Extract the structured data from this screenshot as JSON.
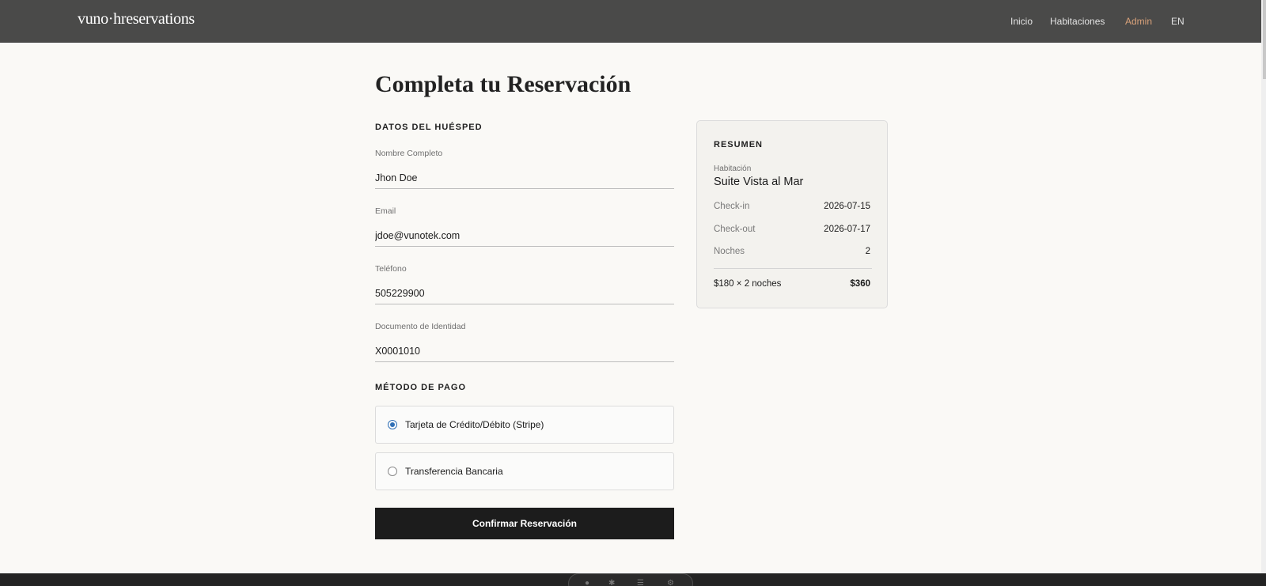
{
  "header": {
    "brand": "vuno·hreservations",
    "nav": [
      "Inicio",
      "Habitaciones",
      "Admin",
      "EN"
    ]
  },
  "page": {
    "title": "Completa tu Reservación"
  },
  "guest": {
    "section_title": "DATOS DEL HUÉSPED",
    "fields": [
      {
        "label": "Nombre Completo",
        "value": "Jhon Doe"
      },
      {
        "label": "Email",
        "value": "jdoe@vunotek.com"
      },
      {
        "label": "Teléfono",
        "value": "505229900"
      },
      {
        "label": "Documento de Identidad",
        "value": "X0001010"
      }
    ]
  },
  "payment": {
    "section_title": "MÉTODO DE PAGO",
    "options": [
      {
        "label": "Tarjeta de Crédito/Débito (Stripe)",
        "selected": true
      },
      {
        "label": "Transferencia Bancaria",
        "selected": false
      }
    ],
    "confirm_label": "Confirmar Reservación"
  },
  "summary": {
    "title": "RESUMEN",
    "room_label": "Habitación",
    "room_name": "Suite Vista al Mar",
    "rows": [
      {
        "label": "Check-in",
        "value": "2026-07-15"
      },
      {
        "label": "Check-out",
        "value": "2026-07-17"
      },
      {
        "label": "Noches",
        "value": "2"
      }
    ],
    "total_label": "$180 × 2 noches",
    "total_value": "$360"
  },
  "footer_toolbar": {
    "icons": [
      "microphone-icon",
      "settings-icon",
      "menu-icon",
      "gear-icon"
    ]
  },
  "colors": {
    "header_bg": "#4a4a49",
    "accent": "#d9a27a",
    "page_bg": "#faf9f6",
    "button_bg": "#1c1c1c",
    "radio_selected": "#2f6fb5"
  }
}
